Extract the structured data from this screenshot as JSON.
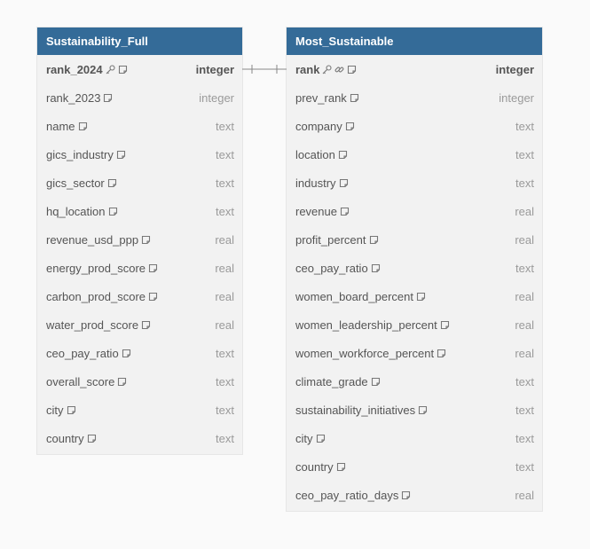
{
  "tables": [
    {
      "id": "t-left",
      "name": "Sustainability_Full",
      "columns": [
        {
          "name": "rank_2024",
          "type": "integer",
          "pk": true,
          "key": true,
          "ref": false
        },
        {
          "name": "rank_2023",
          "type": "integer"
        },
        {
          "name": "name",
          "type": "text"
        },
        {
          "name": "gics_industry",
          "type": "text"
        },
        {
          "name": "gics_sector",
          "type": "text"
        },
        {
          "name": "hq_location",
          "type": "text"
        },
        {
          "name": "revenue_usd_ppp",
          "type": "real"
        },
        {
          "name": "energy_prod_score",
          "type": "real"
        },
        {
          "name": "carbon_prod_score",
          "type": "real"
        },
        {
          "name": "water_prod_score",
          "type": "real"
        },
        {
          "name": "ceo_pay_ratio",
          "type": "text"
        },
        {
          "name": "overall_score",
          "type": "text"
        },
        {
          "name": "city",
          "type": "text"
        },
        {
          "name": "country",
          "type": "text"
        }
      ]
    },
    {
      "id": "t-right",
      "name": "Most_Sustainable",
      "columns": [
        {
          "name": "rank",
          "type": "integer",
          "pk": true,
          "key": true,
          "ref": true
        },
        {
          "name": "prev_rank",
          "type": "integer"
        },
        {
          "name": "company",
          "type": "text"
        },
        {
          "name": "location",
          "type": "text"
        },
        {
          "name": "industry",
          "type": "text"
        },
        {
          "name": "revenue",
          "type": "real"
        },
        {
          "name": "profit_percent",
          "type": "real"
        },
        {
          "name": "ceo_pay_ratio",
          "type": "text"
        },
        {
          "name": "women_board_percent",
          "type": "real"
        },
        {
          "name": "women_leadership_percent",
          "type": "real"
        },
        {
          "name": "women_workforce_percent",
          "type": "real"
        },
        {
          "name": "climate_grade",
          "type": "text"
        },
        {
          "name": "sustainability_initiatives",
          "type": "text"
        },
        {
          "name": "city",
          "type": "text"
        },
        {
          "name": "country",
          "type": "text"
        },
        {
          "name": "ceo_pay_ratio_days",
          "type": "real"
        }
      ]
    }
  ],
  "relationship": {
    "from": "Sustainability_Full.rank_2024",
    "to": "Most_Sustainable.rank",
    "cardinality": "one-to-one"
  },
  "colors": {
    "header": "#346b98",
    "body": "#f2f2f2",
    "text": "#555555",
    "type_text": "#9a9a9a",
    "connector": "#888888"
  },
  "icons": {
    "key": "key-icon",
    "ref": "link-icon",
    "note": "note-icon"
  }
}
